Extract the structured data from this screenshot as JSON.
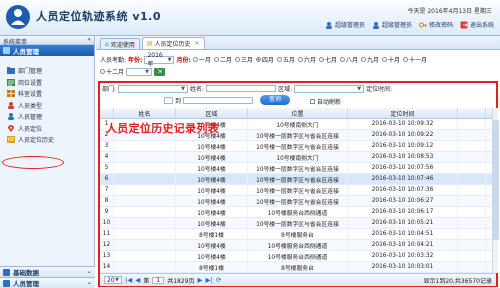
{
  "app": {
    "title": "人员定位轨迹系统 v1.0",
    "date_text": "今天是 2016年4月13日 星期三"
  },
  "top_buttons": [
    {
      "label": "超级管理员",
      "icon": "user-icon"
    },
    {
      "label": "超级管理员",
      "icon": "user-icon"
    },
    {
      "label": "修改密码",
      "icon": "key-icon"
    },
    {
      "label": "退出系统",
      "icon": "exit-icon"
    }
  ],
  "sidebar": {
    "header": "系统菜单",
    "menu_title": "人员管理",
    "items": [
      {
        "label": "部门管理"
      },
      {
        "label": "岗位设置"
      },
      {
        "label": "科室设置"
      },
      {
        "label": "人员类型"
      },
      {
        "label": "人员管理"
      },
      {
        "label": "人员定位"
      },
      {
        "label": "人员定位历史"
      }
    ],
    "bottom": [
      {
        "label": "基础数据"
      },
      {
        "label": "人员管理"
      }
    ]
  },
  "tabs": [
    {
      "label": "欢迎使用"
    },
    {
      "label": "人员定位历史"
    }
  ],
  "filters": {
    "person_label": "人员考勤:",
    "year_label": "年份:",
    "year_value": "2016年",
    "month_label": "月份:",
    "months": [
      "一月",
      "二月",
      "三月",
      "四月",
      "五月",
      "六月",
      "七月",
      "八月",
      "九月",
      "十月",
      "十一月"
    ],
    "month12": "十二月",
    "selected_month": "四月",
    "dept_label": "部门:",
    "name_label": "姓名:",
    "area_label": "区域:",
    "time_label": "定位时间:",
    "to_label": "到",
    "query_button": "查询",
    "auto_refresh": "自动刷新"
  },
  "overlay_label": "人员定位历史记录列表",
  "table": {
    "headers": [
      "",
      "姓名",
      "区域",
      "位置",
      "定位时间"
    ],
    "rows": [
      [
        "1",
        "",
        "10号楼4楼",
        "10号楼南侧大门",
        "2016-03-10 10:09:32"
      ],
      [
        "2",
        "",
        "10号楼4楼",
        "10号楼一层数字区与省会区连接",
        "2016-03-10 10:09:22"
      ],
      [
        "3",
        "",
        "10号楼4楼",
        "10号楼一层数字区与省会区连接",
        "2016-03-10 10:09:12"
      ],
      [
        "4",
        "",
        "10号楼4楼",
        "10号楼南侧大门",
        "2016-03-10 10:08:53"
      ],
      [
        "5",
        "",
        "10号楼4楼",
        "10号楼一层数字区与省会区连接",
        "2016-03-10 10:07:56"
      ],
      [
        "6",
        "",
        "10号楼4楼",
        "10号楼一层数字区与省会区连接",
        "2016-03-10 10:07:46"
      ],
      [
        "7",
        "",
        "10号楼4楼",
        "10号楼一层数字区与省会区连接",
        "2016-03-10 10:07:36"
      ],
      [
        "8",
        "",
        "10号楼4楼",
        "10号楼一层数字区与省会区连接",
        "2016-03-10 10:06:27"
      ],
      [
        "9",
        "",
        "10号楼4楼",
        "10号楼服务台西侧通道",
        "2016-03-10 10:06:17"
      ],
      [
        "10",
        "",
        "10号楼4楼",
        "10号楼一层数字区与省会区连接",
        "2016-03-10 10:05:21"
      ],
      [
        "11",
        "",
        "8号楼1楼",
        "8号楼服务台",
        "2016-03-10 10:04:51"
      ],
      [
        "12",
        "",
        "10号楼4楼",
        "10号楼服务台西侧通道",
        "2016-03-10 10:04:21"
      ],
      [
        "13",
        "",
        "10号楼4楼",
        "10号楼服务台西侧通道",
        "2016-03-10 10:03:32"
      ],
      [
        "14",
        "",
        "8号楼1楼",
        "8号楼服务台",
        "2016-03-10 10:03:01"
      ]
    ]
  },
  "pager": {
    "page_size": "20",
    "page_label": "第",
    "page_value": "1",
    "total_pages": "共1829页",
    "info": "显示1到20,共36570记录"
  },
  "colors": {
    "accent": "#1d5cae",
    "highlight": "#e02020"
  }
}
